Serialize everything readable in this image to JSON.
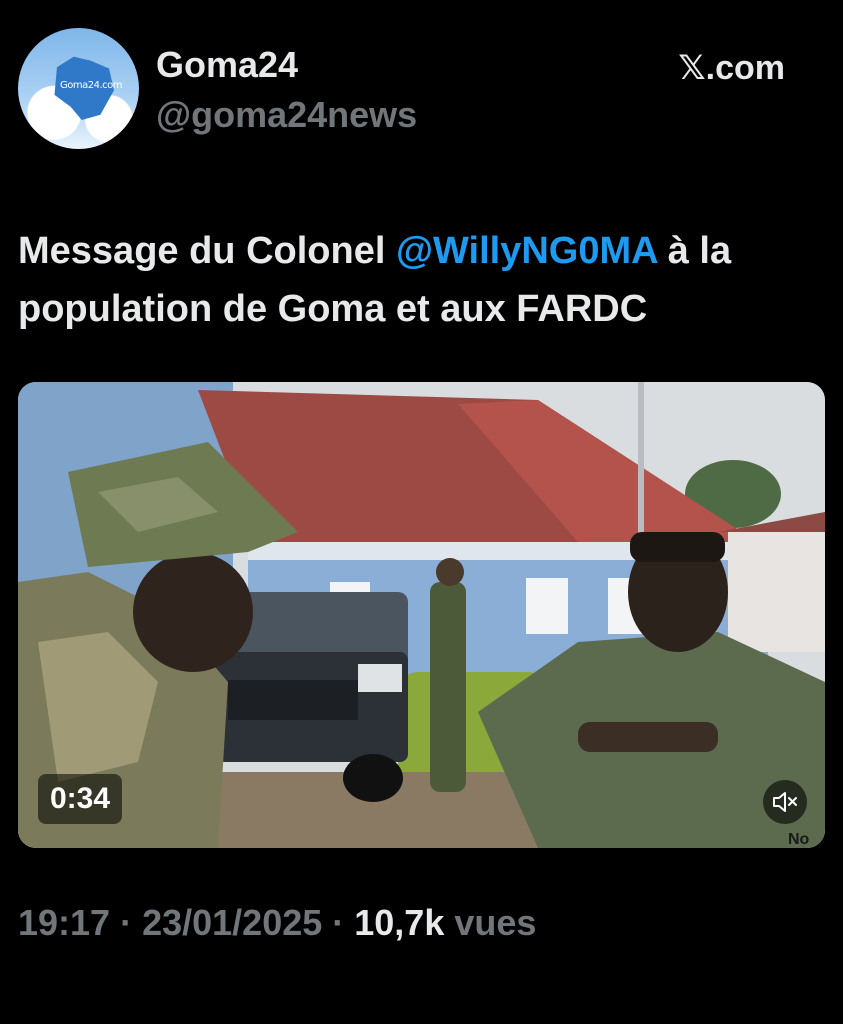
{
  "author": {
    "name": "Goma24",
    "handle": "@goma24news",
    "avatar_text": "Goma24.com"
  },
  "brand": {
    "label": "𝕏.com"
  },
  "tweet": {
    "text_before": "Message du Colonel ",
    "mention": "@WillyNG0MA",
    "text_after": " à la population de Goma et aux FARDC"
  },
  "media": {
    "duration": "0:34",
    "mute_icon": "speaker-muted-icon",
    "watermark": "No"
  },
  "meta": {
    "time": "19:17",
    "separator": " · ",
    "date": "23/01/2025",
    "views_count": "10,7k",
    "views_label": " vues"
  },
  "colors": {
    "background": "#000000",
    "text": "#e7e9ea",
    "secondary": "#71767b",
    "link": "#1d9bf0"
  }
}
